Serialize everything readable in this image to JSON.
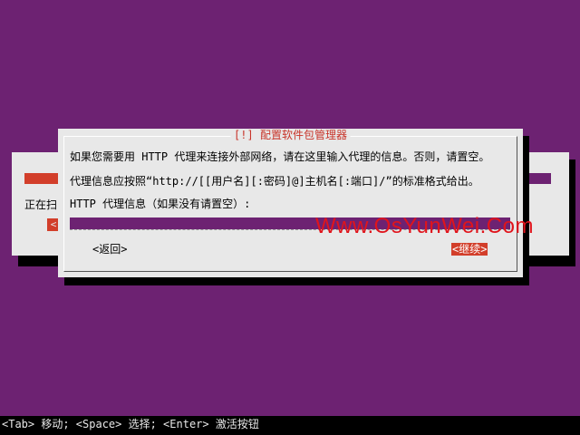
{
  "background_dialog": {
    "status_text": "正在扫",
    "cancel_stub": "<",
    "progress_fraction_visible": 0.07
  },
  "dialog": {
    "title": "[!] 配置软件包管理器",
    "line1": "如果您需要用 HTTP 代理来连接外部网络，请在这里输入代理的信息。否则，请置空。",
    "line2": "代理信息应按照“http://[[用户名][:密码]@]主机名[:端口]/”的标准格式给出。",
    "label": "HTTP 代理信息（如果没有请置空）:",
    "input_value": "",
    "back_label": "<返回>",
    "continue_label": "<继续>"
  },
  "watermark": "Www.OsYunWei.Com",
  "help_bar": "<Tab> 移动; <Space> 选择; <Enter> 激活按钮",
  "colors": {
    "desktop": "#6d2272",
    "dialog": "#e8e8e8",
    "accent": "#d23e2a",
    "watermark": "#e0141c"
  }
}
